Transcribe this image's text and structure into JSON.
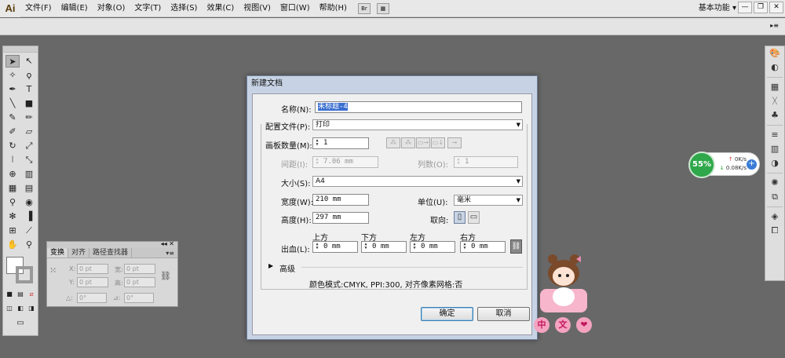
{
  "app": {
    "logo": "Ai"
  },
  "menu": [
    "文件(F)",
    "编辑(E)",
    "对象(O)",
    "文字(T)",
    "选择(S)",
    "效果(C)",
    "视图(V)",
    "窗口(W)",
    "帮助(H)"
  ],
  "menu_icons": {
    "bridge": "Br",
    "arrange": "arrange-documents-icon"
  },
  "workspace": {
    "label": "基本功能 ▾"
  },
  "window_controls": {
    "minimize": "—",
    "restore": "❐",
    "close": "✕"
  },
  "transform_panel": {
    "tabs": [
      "变换",
      "对齐",
      "路径查找器"
    ],
    "labels": {
      "x": "X:",
      "y": "Y:",
      "w": "宽:",
      "h": "高:",
      "rot": "△:",
      "shear": "⊿:"
    },
    "values": {
      "x": "0 pt",
      "y": "0 pt",
      "w": "0 pt",
      "h": "0 pt",
      "rot": "0°",
      "shear": "0°"
    }
  },
  "dialog": {
    "title": "新建文档",
    "name_label": "名称(N):",
    "name_value": "未标题-4",
    "profile_label": "配置文件(P):",
    "profile_value": "打印",
    "artboards_label": "画板数量(M):",
    "artboards_value": "1",
    "spacing_label": "间距(I):",
    "spacing_value": "7.06 mm",
    "columns_label": "列数(O):",
    "columns_value": "1",
    "size_label": "大小(S):",
    "size_value": "A4",
    "width_label": "宽度(W):",
    "width_value": "210 mm",
    "units_label": "单位(U):",
    "units_value": "毫米",
    "height_label": "高度(H):",
    "height_value": "297 mm",
    "orientation_label": "取向:",
    "bleed_label": "出血(L):",
    "bleed_top_label": "上方",
    "bleed_bottom_label": "下方",
    "bleed_left_label": "左方",
    "bleed_right_label": "右方",
    "bleed_top": "0 mm",
    "bleed_bottom": "0 mm",
    "bleed_left": "0 mm",
    "bleed_right": "0 mm",
    "advanced_label": "高级",
    "info": "颜色模式:CMYK, PPI:300, 对齐像素网格:否",
    "ok": "确定",
    "cancel": "取消"
  },
  "network_widget": {
    "percent": "55%",
    "up": "0K/s",
    "down": "0.08K/s"
  },
  "mascot": {
    "chars": [
      "中",
      "文",
      "❤"
    ]
  },
  "colors": {
    "accent": "#3a6ed0",
    "network_green": "#2ea84a"
  }
}
